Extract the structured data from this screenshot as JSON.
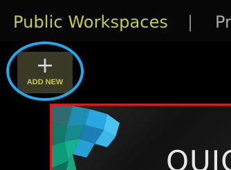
{
  "nav": {
    "title": "Public Workspaces",
    "separator": "|",
    "next_item": "Pr"
  },
  "add_new": {
    "icon": "plus-icon",
    "label": "ADD NEW"
  },
  "card": {
    "title": "QUIC"
  },
  "colors": {
    "accent": "#c8c94a",
    "highlight": "#1faaf0",
    "card_border": "#e01818",
    "background": "#000000"
  }
}
